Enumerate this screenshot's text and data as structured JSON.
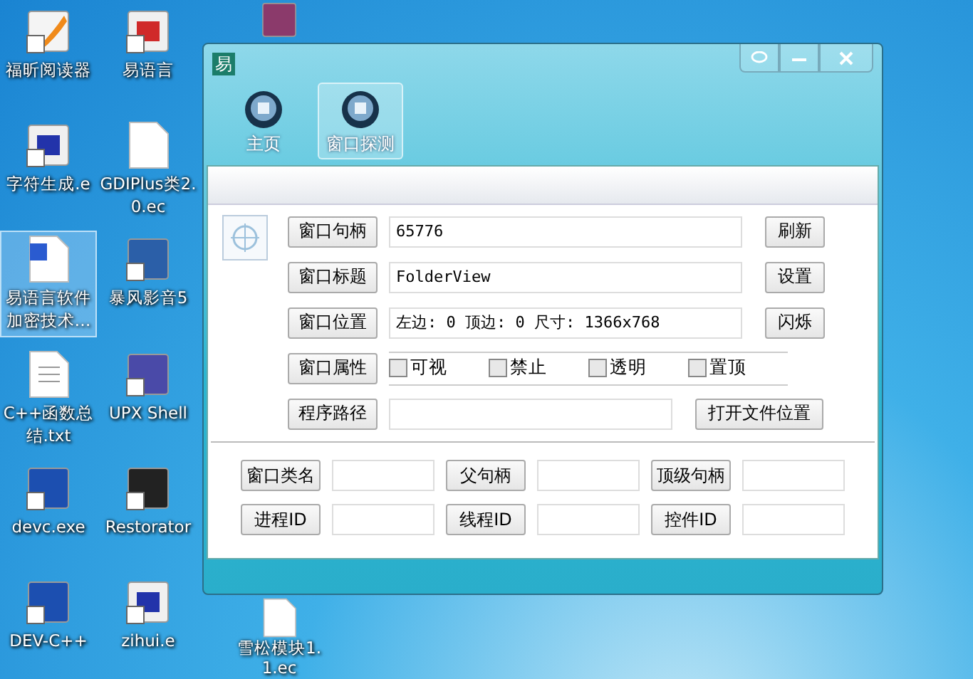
{
  "desktop": {
    "columns": [
      [
        {
          "label": "福昕阅读器",
          "kind": "pdf",
          "selected": false
        },
        {
          "label": "字符生成.e",
          "kind": "e-source",
          "selected": false
        },
        {
          "label": "易语言软件加密技术…",
          "kind": "word",
          "selected": true
        },
        {
          "label": "C++函数总结.txt",
          "kind": "text",
          "selected": false
        },
        {
          "label": "devc.exe",
          "kind": "dev",
          "selected": false
        },
        {
          "label": "DEV-C++",
          "kind": "dev",
          "selected": false
        }
      ],
      [
        {
          "label": "易语言",
          "kind": "e-app",
          "selected": false
        },
        {
          "label": "GDIPlus类2.0.ec",
          "kind": "blank",
          "selected": false
        },
        {
          "label": "暴风影音5",
          "kind": "player",
          "selected": false
        },
        {
          "label": "UPX Shell",
          "kind": "upx",
          "selected": false
        },
        {
          "label": "Restorator",
          "kind": "res",
          "selected": false
        },
        {
          "label": "zihui.e",
          "kind": "e-source",
          "selected": false
        }
      ],
      [
        {
          "kind": "archive",
          "selected": false
        },
        {
          "label": "雪松模块1.1.ec",
          "kind": "blank",
          "selected": false
        }
      ]
    ]
  },
  "window": {
    "title_logo": "易",
    "tabs": [
      {
        "label": "主页",
        "selected": false
      },
      {
        "label": "窗口探测",
        "selected": true
      }
    ],
    "rows": [
      {
        "kind": "field",
        "button": "窗口句柄",
        "value": "65776",
        "action": "刷新"
      },
      {
        "kind": "field",
        "button": "窗口标题",
        "value": "FolderView",
        "action": "设置"
      },
      {
        "kind": "field",
        "button": "窗口位置",
        "value": "左边: 0 顶边: 0 尺寸: 1366x768",
        "action": "闪烁"
      },
      {
        "kind": "checks",
        "button": "窗口属性",
        "checks": [
          {
            "label": "可视",
            "checked": false
          },
          {
            "label": "禁止",
            "checked": false
          },
          {
            "label": "透明",
            "checked": false
          },
          {
            "label": "置顶",
            "checked": false
          }
        ]
      },
      {
        "kind": "path",
        "button": "程序路径",
        "action": "打开文件位置"
      }
    ],
    "info": [
      [
        "窗口类名",
        "父句柄",
        "顶级句柄"
      ],
      [
        "进程ID",
        "线程ID",
        "控件ID"
      ]
    ]
  }
}
